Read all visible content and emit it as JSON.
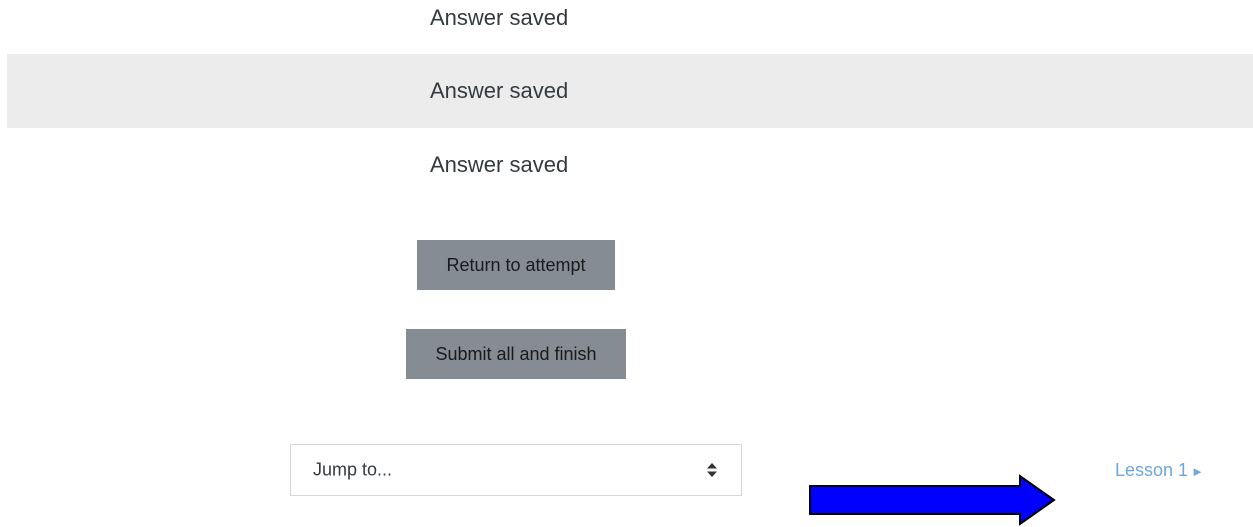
{
  "summary": {
    "rows": [
      {
        "status": "Answer saved",
        "shaded": false
      },
      {
        "status": "Answer saved",
        "shaded": true
      },
      {
        "status": "Answer saved",
        "shaded": false
      }
    ]
  },
  "actions": {
    "return_label": "Return to attempt",
    "submit_label": "Submit all and finish"
  },
  "navigation": {
    "jump_placeholder": "Jump to...",
    "next_link_label": "Lesson 1",
    "next_link_arrow": "►"
  },
  "colors": {
    "button_bg": "#858c94",
    "link": "#6fa7dd",
    "annotation_arrow": "#0000ff",
    "row_shade": "#ececec"
  }
}
